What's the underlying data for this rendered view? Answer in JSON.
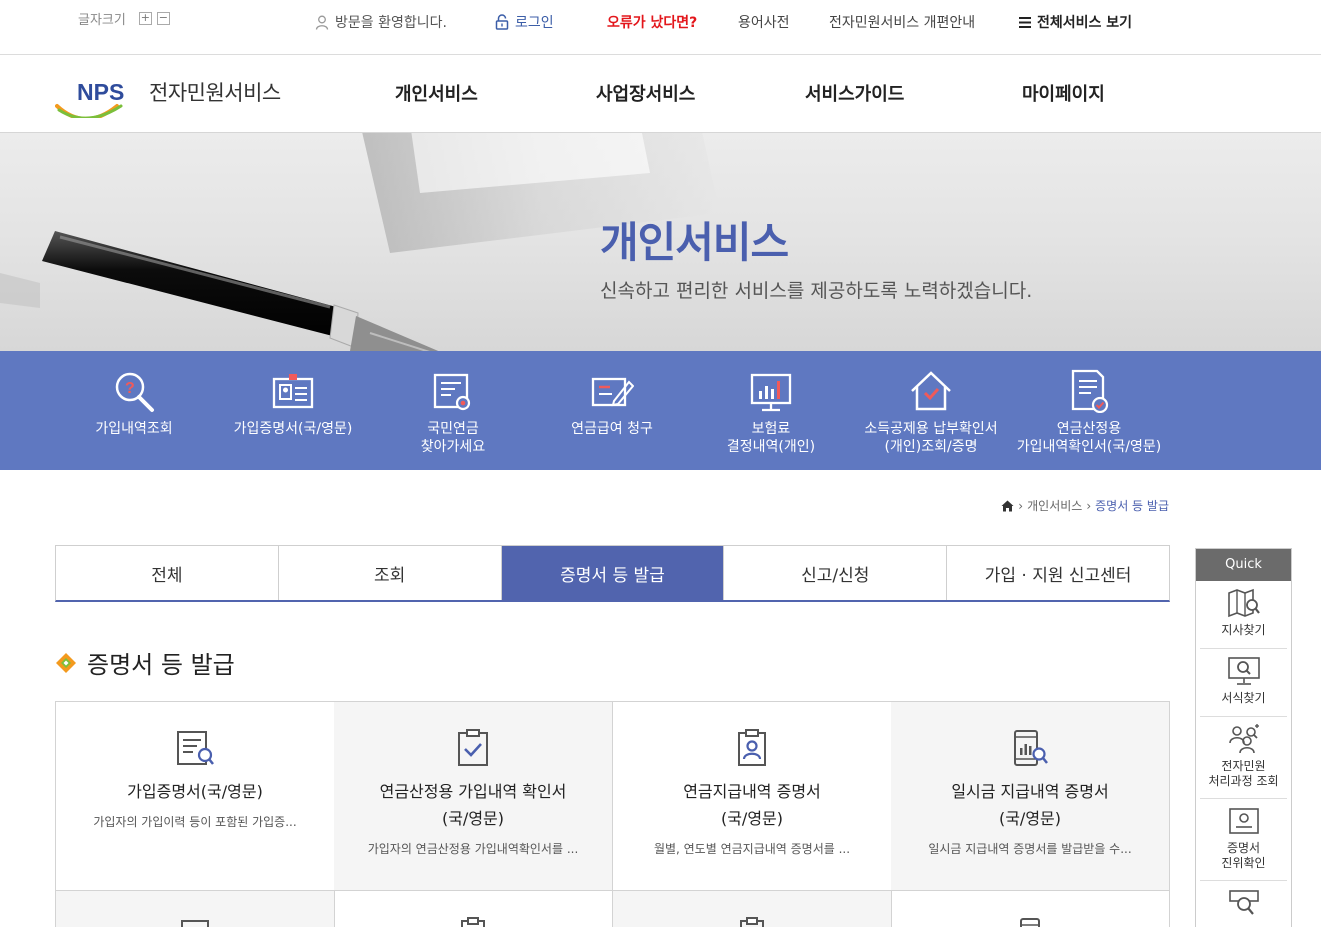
{
  "util": {
    "font_size_label": "글자크기",
    "font_plus": "+",
    "font_minus": "−",
    "welcome": "방문을 환영합니다.",
    "login": "로그인",
    "error": "오류가 났다면?",
    "dictionary": "용어사전",
    "renewal": "전자민원서비스 개편안내",
    "all_services": "전체서비스 보기"
  },
  "logo": {
    "mark": "NPS",
    "text": "전자민원서비스"
  },
  "gnb": [
    "개인서비스",
    "사업장서비스",
    "서비스가이드",
    "마이페이지"
  ],
  "hero": {
    "title": "개인서비스",
    "subtitle": "신속하고 편리한 서비스를 제공하도록 노력하겠습니다."
  },
  "quick_strip": [
    {
      "line1": "가입내역조회",
      "line2": "",
      "icon": "search-question-icon"
    },
    {
      "line1": "가입증명서(국/영문)",
      "line2": "",
      "icon": "id-card-icon"
    },
    {
      "line1": "국민연금",
      "line2": "찾아가세요",
      "icon": "document-search-icon"
    },
    {
      "line1": "연금급여 청구",
      "line2": "",
      "icon": "form-pencil-icon"
    },
    {
      "line1": "보험료",
      "line2": "결정내역(개인)",
      "icon": "monitor-chart-icon"
    },
    {
      "line1": "소득공제용 납부확인서",
      "line2": "(개인)조회/증명",
      "icon": "house-check-icon"
    },
    {
      "line1": "연금산정용",
      "line2": "가입내역확인서(국/영문)",
      "icon": "document-check-icon"
    }
  ],
  "breadcrumb": {
    "level1": "개인서비스",
    "current": "증명서 등 발급"
  },
  "tabs": [
    {
      "label": "전체",
      "active": false
    },
    {
      "label": "조회",
      "active": false
    },
    {
      "label": "증명서 등 발급",
      "active": true
    },
    {
      "label": "신고/신청",
      "active": false
    },
    {
      "label": "가입 · 지원 신고센터",
      "active": false
    }
  ],
  "section_title": "증명서 등 발급",
  "cards": [
    {
      "title1": "가입증명서(국/영문)",
      "title2": "",
      "desc": "가입자의 가입이력 등이 포함된 가입증...",
      "icon": "document-search-icon"
    },
    {
      "title1": "연금산정용 가입내역 확인서",
      "title2": "(국/영문)",
      "desc": "가입자의 연금산정용 가입내역확인서를 ...",
      "icon": "clipboard-check-icon"
    },
    {
      "title1": "연금지급내역 증명서",
      "title2": "(국/영문)",
      "desc": "월별, 연도별 연금지급내역 증명서를 ...",
      "icon": "clipboard-person-icon"
    },
    {
      "title1": "일시금 지급내역 증명서",
      "title2": "(국/영문)",
      "desc": "일시금 지급내역 증명서를 발급받을 수...",
      "icon": "phone-chart-icon"
    }
  ],
  "side": {
    "header": "Quick",
    "items": [
      {
        "line1": "지사찾기",
        "line2": "",
        "icon": "map-search-icon"
      },
      {
        "line1": "서식찾기",
        "line2": "",
        "icon": "monitor-search-icon"
      },
      {
        "line1": "전자민원",
        "line2": "처리과정 조회",
        "icon": "people-search-icon"
      },
      {
        "line1": "증명서",
        "line2": "진위확인",
        "icon": "certificate-icon"
      }
    ]
  },
  "colors": {
    "brand_blue": "#5164ae",
    "strip_blue": "#5f78c1",
    "error_red": "#e3161b"
  }
}
